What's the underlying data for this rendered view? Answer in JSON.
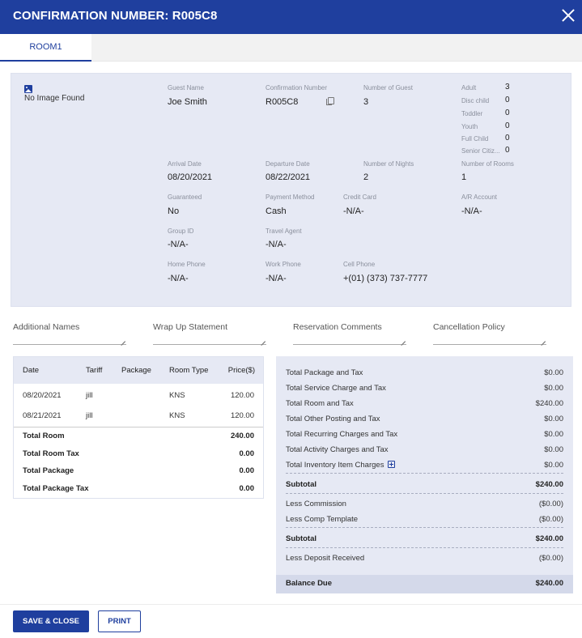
{
  "header": {
    "title": "CONFIRMATION NUMBER: R005C8",
    "close_icon": "close-icon"
  },
  "tabs": [
    {
      "label": "ROOM1"
    }
  ],
  "guest": {
    "no_image_icon": "image-icon",
    "no_image_text": "No Image Found",
    "fields": {
      "guest_name": {
        "label": "Guest Name",
        "value": "Joe Smith"
      },
      "confirmation_number": {
        "label": "Confirmation Number",
        "value": "R005C8"
      },
      "number_of_guest": {
        "label": "Number of Guest",
        "value": "3"
      },
      "arrival_date": {
        "label": "Arrival Date",
        "value": "08/20/2021"
      },
      "departure_date": {
        "label": "Departure Date",
        "value": "08/22/2021"
      },
      "number_of_nights": {
        "label": "Number of Nights",
        "value": "2"
      },
      "number_of_rooms": {
        "label": "Number of Rooms",
        "value": "1"
      },
      "guaranteed": {
        "label": "Guaranteed",
        "value": "No"
      },
      "payment_method": {
        "label": "Payment Method",
        "value": "Cash"
      },
      "credit_card": {
        "label": "Credit Card",
        "value": "-N/A-"
      },
      "ar_account": {
        "label": "A/R Account",
        "value": "-N/A-"
      },
      "group_id": {
        "label": "Group ID",
        "value": "-N/A-"
      },
      "travel_agent": {
        "label": "Travel Agent",
        "value": "-N/A-"
      },
      "home_phone": {
        "label": "Home Phone",
        "value": "-N/A-"
      },
      "work_phone": {
        "label": "Work Phone",
        "value": "-N/A-"
      },
      "cell_phone": {
        "label": "Cell Phone",
        "value": "+(01) (373) 737-7777"
      }
    },
    "occupants": [
      {
        "label": "Adult",
        "value": "3"
      },
      {
        "label": "Disc child",
        "value": "0"
      },
      {
        "label": "Toddler",
        "value": "0"
      },
      {
        "label": "Youth",
        "value": "0"
      },
      {
        "label": "Full Child",
        "value": "0"
      },
      {
        "label": "Senior Citiz...",
        "value": "0"
      }
    ]
  },
  "notes": [
    {
      "label": "Additional Names",
      "value": ""
    },
    {
      "label": "Wrap Up Statement",
      "value": ""
    },
    {
      "label": "Reservation Comments",
      "value": ""
    },
    {
      "label": "Cancellation Policy",
      "value": ""
    }
  ],
  "rate_table": {
    "columns": [
      "Date",
      "Tariff",
      "Package",
      "Room Type",
      "Price($)"
    ],
    "rows": [
      {
        "date": "08/20/2021",
        "tariff": "jill",
        "package": "",
        "room_type": "KNS",
        "price": "120.00"
      },
      {
        "date": "08/21/2021",
        "tariff": "jill",
        "package": "",
        "room_type": "KNS",
        "price": "120.00"
      }
    ],
    "totals": [
      {
        "label": "Total Room",
        "value": "240.00"
      },
      {
        "label": "Total Room Tax",
        "value": "0.00"
      },
      {
        "label": "Total Package",
        "value": "0.00"
      },
      {
        "label": "Total Package Tax",
        "value": "0.00"
      }
    ]
  },
  "summary": {
    "charges": [
      {
        "label": "Total Package and Tax",
        "value": "$0.00"
      },
      {
        "label": "Total Service Charge and Tax",
        "value": "$0.00"
      },
      {
        "label": "Total Room and Tax",
        "value": "$240.00"
      },
      {
        "label": "Total Other Posting and Tax",
        "value": "$0.00"
      },
      {
        "label": "Total Recurring Charges and Tax",
        "value": "$0.00"
      },
      {
        "label": "Total Activity Charges and Tax",
        "value": "$0.00"
      },
      {
        "label": "Total Inventory Item Charges",
        "value": "$0.00"
      }
    ],
    "subtotal1": {
      "label": "Subtotal",
      "value": "$240.00"
    },
    "less_commission": {
      "label": "Less Commission",
      "value": "($0.00)"
    },
    "less_comp_template": {
      "label": "Less Comp Template",
      "value": "($0.00)"
    },
    "subtotal2": {
      "label": "Subtotal",
      "value": "$240.00"
    },
    "less_deposit": {
      "label": "Less Deposit Received",
      "value": "($0.00)"
    },
    "balance_due": {
      "label": "Balance Due",
      "value": "$240.00"
    }
  },
  "footer": {
    "save_close_label": "SAVE & CLOSE",
    "print_label": "PRINT"
  }
}
